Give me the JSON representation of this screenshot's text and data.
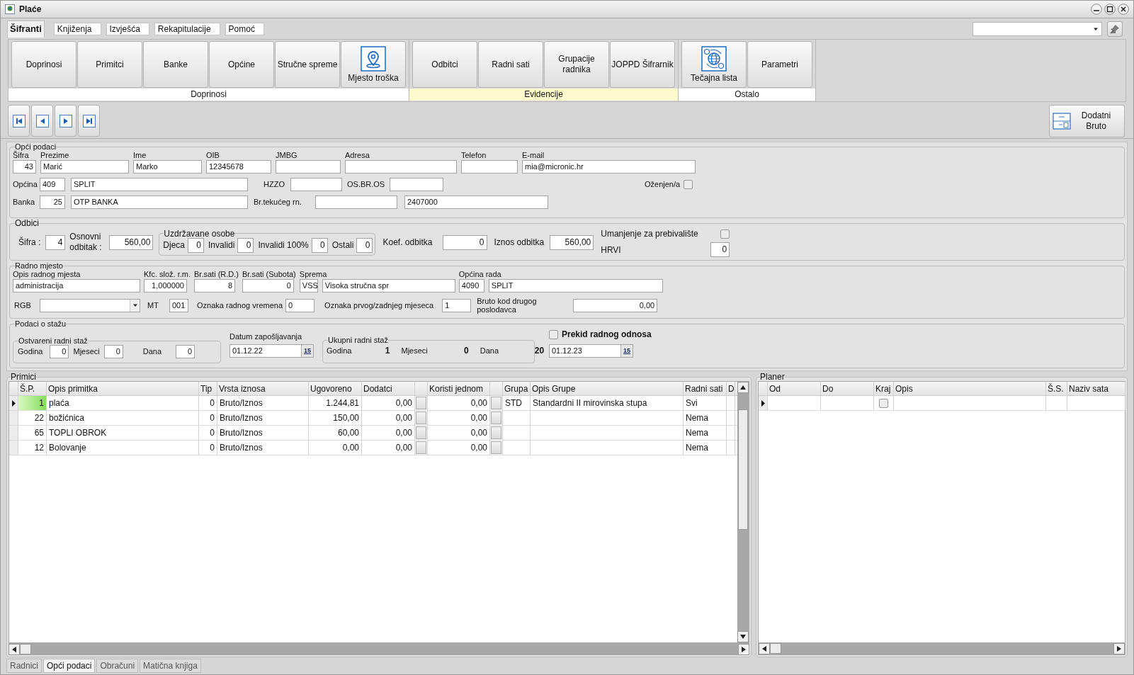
{
  "window": {
    "title": "Plaće"
  },
  "ribbon": {
    "tabs": [
      {
        "label": "Šifranti",
        "selected": true
      },
      {
        "label": "Knjiženja",
        "selected": false
      },
      {
        "label": "Izvješća",
        "selected": false
      },
      {
        "label": "Rekapitulacije",
        "selected": false
      },
      {
        "label": "Pomoć",
        "selected": false
      }
    ],
    "groups": [
      {
        "label": "Doprinosi",
        "highlighted": false,
        "buttons": [
          {
            "label": "Doprinosi"
          },
          {
            "label": "Primitci"
          },
          {
            "label": "Banke"
          },
          {
            "label": "Općine"
          },
          {
            "label": "Stručne spreme"
          },
          {
            "label": "Mjesto troška",
            "kind": "pin"
          }
        ]
      },
      {
        "label": "Evidencije",
        "highlighted": true,
        "buttons": [
          {
            "label": "Odbitci"
          },
          {
            "label": "Radni sati"
          },
          {
            "label": "Grupacije radnika"
          },
          {
            "label": "JOPPD Šifrarnik"
          }
        ]
      },
      {
        "label": "Ostalo",
        "highlighted": false,
        "buttons": [
          {
            "label": "Tečajna lista",
            "kind": "globe"
          },
          {
            "label": "Parametri"
          }
        ]
      }
    ]
  },
  "toolbar": {
    "extra_button": {
      "label": "Dodatni Bruto"
    }
  },
  "general": {
    "title": "Opći podaci",
    "row1": [
      {
        "label": "Šifra",
        "value": "43"
      },
      {
        "label": "Prezime",
        "value": "Marić"
      },
      {
        "label": "Ime",
        "value": "Marko"
      },
      {
        "label": "OIB",
        "value": "12345678"
      },
      {
        "label": "JMBG"
      },
      {
        "label": "Adresa"
      },
      {
        "label": "Telefon"
      },
      {
        "label": "E-mail",
        "value": "mia@micronic.hr"
      }
    ],
    "opcina": {
      "label": "Općina",
      "code": "409",
      "name": "SPLIT"
    },
    "hzzo": {
      "label": "HZZO"
    },
    "osbros": {
      "label": "OS.BR.OS"
    },
    "married": {
      "label": "Oženjen/a",
      "checked": false
    },
    "banka": {
      "label": "Banka",
      "code": "25",
      "name": "OTP BANKA"
    },
    "account": {
      "label": "Br.tekućeg rn.",
      "value2": "2407000"
    }
  },
  "odbici": {
    "title": "Odbici",
    "sifra": {
      "label": "Šifra :",
      "value": "4"
    },
    "osnovni": {
      "label": "Osnovni odbitak :",
      "value": "560,00"
    },
    "uzdrzavane": {
      "title": "Uzdržavane osobe",
      "items": [
        {
          "label": "Djeca",
          "value": "0"
        },
        {
          "label": "Invalidi",
          "value": "0"
        },
        {
          "label": "Invalidi 100%",
          "value": "0"
        },
        {
          "label": "Ostali",
          "value": "0"
        }
      ]
    },
    "koef": {
      "label": "Koef. odbitka",
      "value": "0"
    },
    "iznos": {
      "label": "Iznos odbitka",
      "value": "560,00"
    },
    "umanjenje": {
      "label": "Umanjenje za prebivalište",
      "checked": false
    },
    "hrvi": {
      "label": "HRVI",
      "value": "0"
    }
  },
  "radno_mjesto": {
    "title": "Radno mjesto",
    "row1": [
      {
        "label": "Opis radnog mjesta",
        "value": "administracija"
      },
      {
        "label": "Kfc. slož. r.m.",
        "value": "1,000000"
      },
      {
        "label": "Br.sati (R.D.)",
        "value": "8"
      },
      {
        "label": "Br.sati (Subota)",
        "value": "0"
      }
    ],
    "sprema": {
      "label": "Sprema",
      "code": "VSS",
      "name": "Visoka stručna spr"
    },
    "opcina_rada": {
      "label": "Općina rada",
      "code": "4090",
      "name": "SPLIT"
    },
    "rgb": {
      "label": "RGB"
    },
    "mt": {
      "label": "MT",
      "value": "001"
    },
    "oznaka_rv": {
      "label": "Oznaka radnog vremena",
      "value": "0"
    },
    "oznaka_pz": {
      "label": "Oznaka prvog/zadnjeg mjeseca",
      "value": "1"
    },
    "bruto": {
      "label": "Bruto kod drugog poslodavca",
      "value": "0,00"
    }
  },
  "staz": {
    "title": "Podaci o stažu",
    "ostvareni": {
      "title": "Ostvareni radni staž",
      "items": [
        {
          "label": "Godina",
          "value": "0"
        },
        {
          "label": "Mjeseci",
          "value": "0"
        },
        {
          "label": "Dana",
          "value": "0"
        }
      ]
    },
    "datum": {
      "label": "Datum zapošljavanja",
      "value": "01.12.22",
      "calendar_label": "15"
    },
    "ukupni": {
      "title": "Ukupni radni staž",
      "items": [
        {
          "label": "Godina",
          "value": "1"
        },
        {
          "label": "Mjeseci",
          "value": "0"
        },
        {
          "label": "Dana",
          "value": "20"
        }
      ]
    },
    "prekid": {
      "label": "Prekid radnog odnosa",
      "checked": false,
      "value": "01.12.23",
      "calendar_label": "15"
    }
  },
  "primici": {
    "title": "Primici",
    "columns": [
      "Š.P.",
      "Opis primitka",
      "Tip",
      "Vrsta iznosa",
      "Ugovoreno",
      "Dodatci",
      "Koristi jednom",
      "Grupa",
      "Opis Grupe",
      "Radni sati",
      "D"
    ],
    "rows": [
      {
        "selected": true,
        "sp": "1",
        "opis": "plaća",
        "tip": "0",
        "vrsta": "Bruto/Iznos",
        "ugovoreno": "1.244,81",
        "dodatci": "0,00",
        "koristi": "0,00",
        "grupa": "STD",
        "opis_grupe": "Standardni II mirovinska stupa",
        "radni_sati": "Svi"
      },
      {
        "selected": false,
        "sp": "22",
        "opis": "božićnica",
        "tip": "0",
        "vrsta": "Bruto/Iznos",
        "ugovoreno": "150,00",
        "dodatci": "0,00",
        "koristi": "0,00",
        "radni_sati": "Nema"
      },
      {
        "selected": false,
        "sp": "65",
        "opis": "TOPLI OBROK",
        "tip": "0",
        "vrsta": "Bruto/Iznos",
        "ugovoreno": "60,00",
        "dodatci": "0,00",
        "koristi": "0,00",
        "radni_sati": "Nema"
      },
      {
        "selected": false,
        "sp": "12",
        "opis": "Bolovanje",
        "tip": "0",
        "vrsta": "Bruto/Iznos",
        "ugovoreno": "0,00",
        "dodatci": "0,00",
        "koristi": "0,00",
        "radni_sati": "Nema"
      }
    ]
  },
  "planer": {
    "title": "Planer",
    "columns": [
      "Od",
      "Do",
      "Kraj",
      "Opis",
      "Š.S.",
      "Naziv sata"
    ],
    "rows": [
      {
        "selected": true,
        "kraj": false
      }
    ]
  },
  "bottom_tabs": [
    {
      "label": "Radnici",
      "selected": false
    },
    {
      "label": "Opći podaci",
      "selected": true
    },
    {
      "label": "Obračuni",
      "selected": false
    },
    {
      "label": "Matična knjiga",
      "selected": false
    }
  ]
}
